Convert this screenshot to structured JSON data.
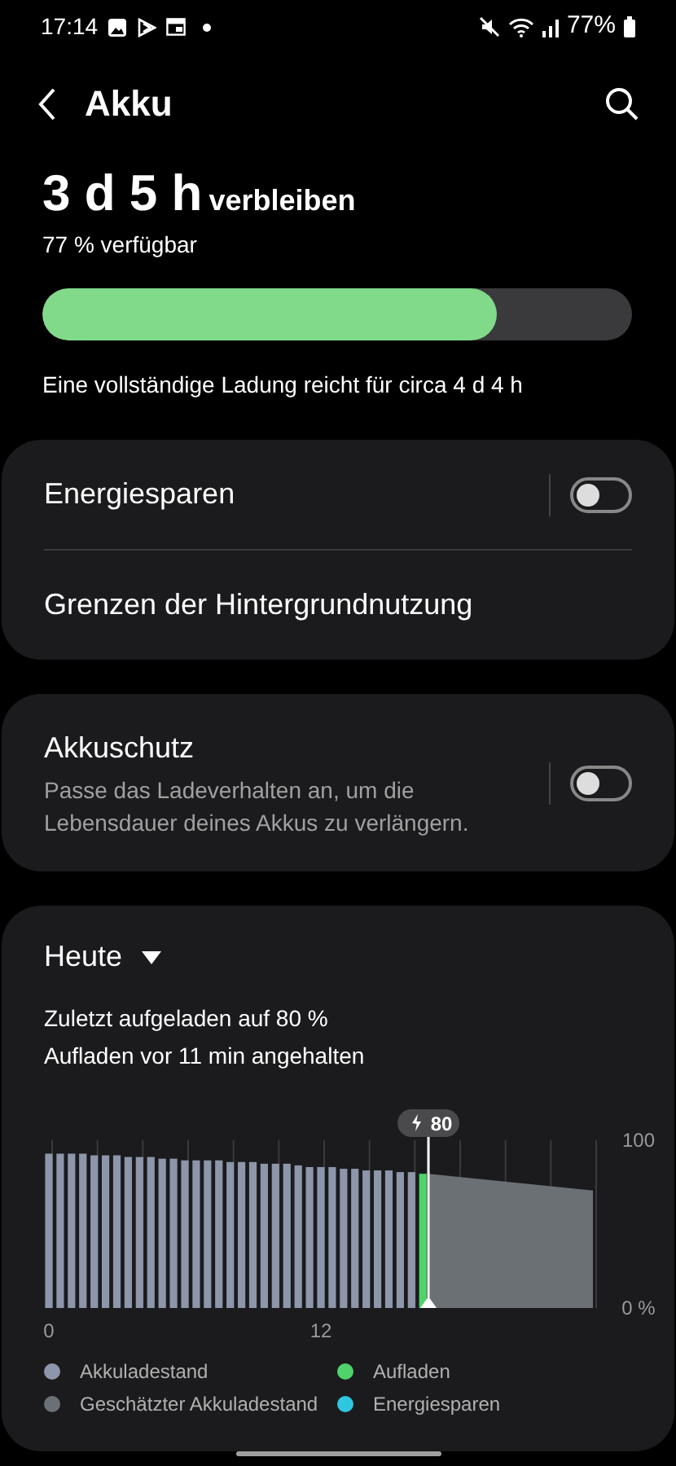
{
  "status_bar": {
    "time": "17:14",
    "battery": "77%"
  },
  "header": {
    "title": "Akku"
  },
  "summary": {
    "remaining": "3 d 5 h",
    "remaining_label": "verbleiben",
    "available": "77 % verfügbar",
    "level": 0.77,
    "full_charge": "Eine vollständige Ladung reicht für circa 4 d 4 h"
  },
  "groups": [
    {
      "items": [
        {
          "kind": "toggle",
          "label": "Energiesparen",
          "on": false
        },
        {
          "kind": "link",
          "label": "Grenzen der Hintergrundnutzung"
        }
      ]
    },
    {
      "items": [
        {
          "kind": "toggle",
          "label": "Akkuschutz",
          "description": "Passe das Ladeverhalten an, um die Lebensdauer deines Akkus zu verlängern.",
          "on": false
        }
      ]
    }
  ],
  "usage": {
    "period": "Heute",
    "lines": [
      "Zuletzt aufgeladen auf 80 %",
      "Aufladen vor 11 min angehalten"
    ],
    "marker_label": "80",
    "chart_data": {
      "type": "bar",
      "x": [
        0,
        0.5,
        1,
        1.5,
        2,
        2.5,
        3,
        3.5,
        4,
        4.5,
        5,
        5.5,
        6,
        6.5,
        7,
        7.5,
        8,
        8.5,
        9,
        9.5,
        10,
        10.5,
        11,
        11.5,
        12,
        12.5,
        13,
        13.5,
        14,
        14.5,
        15,
        15.5,
        16,
        16.5
      ],
      "ref_lines": [
        {
          "axis": "x",
          "value": 16.6
        }
      ],
      "xlim": [
        0,
        24
      ],
      "ylim": [
        0,
        100
      ],
      "xticks": [
        0,
        12
      ],
      "yticks": [
        {
          "value": 0,
          "label": "0 %"
        },
        {
          "value": 100,
          "label": "100"
        }
      ],
      "series": [
        {
          "name": "Akkuladestand",
          "color": "#8d96aa",
          "values": [
            92,
            92,
            92,
            92,
            91,
            91,
            91,
            90,
            90,
            90,
            89,
            89,
            88,
            88,
            88,
            88,
            87,
            87,
            87,
            86,
            86,
            86,
            85,
            84,
            84,
            84,
            83,
            83,
            82,
            82,
            82,
            81,
            81,
            null
          ]
        },
        {
          "name": "Aufladen",
          "color": "#4fd36a",
          "values": [
            null,
            null,
            null,
            null,
            null,
            null,
            null,
            null,
            null,
            null,
            null,
            null,
            null,
            null,
            null,
            null,
            null,
            null,
            null,
            null,
            null,
            null,
            null,
            null,
            null,
            null,
            null,
            null,
            null,
            null,
            null,
            null,
            null,
            80
          ]
        }
      ]
    },
    "legend_extra": [
      {
        "label": "Geschätzter Akkuladestand",
        "color": "#6b7075"
      },
      {
        "label": "Energiesparen",
        "color": "#2fc6e0"
      }
    ]
  }
}
